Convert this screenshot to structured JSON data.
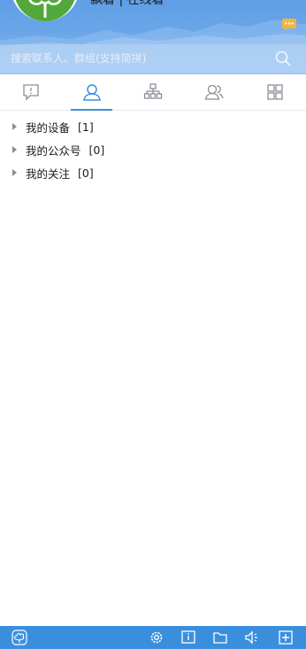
{
  "user": {
    "nickname": "飘着 | 在线着"
  },
  "search": {
    "placeholder": "搜索联系人、群组(支持简拼)"
  },
  "tabs": [
    {
      "name": "recent-chats",
      "icon": "chat-bubble-icon"
    },
    {
      "name": "contacts",
      "icon": "contact-person-icon",
      "active": true
    },
    {
      "name": "organization",
      "icon": "org-chart-icon"
    },
    {
      "name": "groups",
      "icon": "group-icon"
    },
    {
      "name": "apps",
      "icon": "grid-icon"
    }
  ],
  "groups": [
    {
      "label": "我的设备",
      "count": "[1]"
    },
    {
      "label": "我的公众号",
      "count": "[0]"
    },
    {
      "label": "我的关注",
      "count": "[0]"
    }
  ],
  "bottom_bar": {
    "left_icon": "app-logo-icon",
    "right_icons": [
      "settings-icon",
      "info-icon",
      "folder-icon",
      "volume-icon",
      "add-icon"
    ]
  },
  "colors": {
    "header": "#6aa6e8",
    "tab_active": "#3b8fdc",
    "bottom_bar": "#3a8fdd",
    "avatar": "#52a83b",
    "badge": "#f5b43c"
  }
}
